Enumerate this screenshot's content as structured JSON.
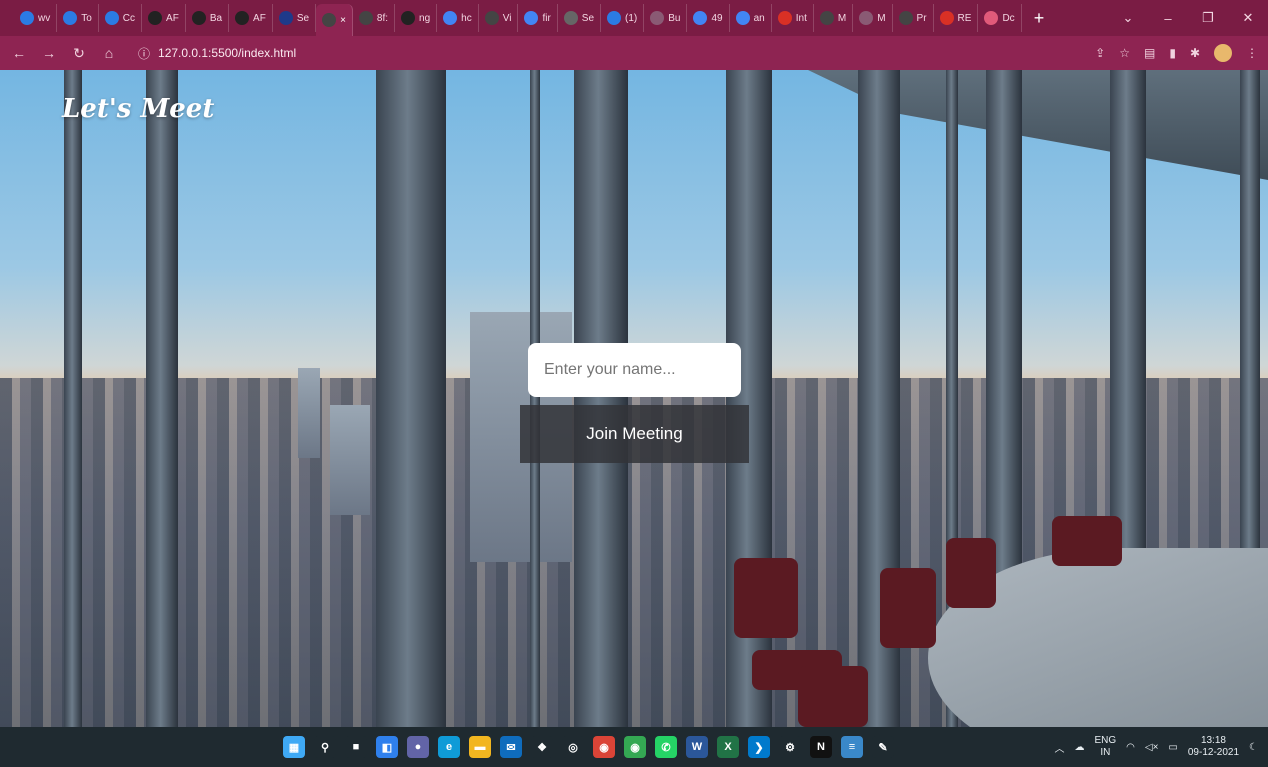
{
  "browser": {
    "tabs": [
      {
        "label": "wv",
        "icon": "site-icon",
        "color": "#2b7be4"
      },
      {
        "label": "To",
        "icon": "site-icon",
        "color": "#2b7be4"
      },
      {
        "label": "Cc",
        "icon": "site-icon",
        "color": "#2b7be4"
      },
      {
        "label": "AF",
        "icon": "github-icon",
        "color": "#222222"
      },
      {
        "label": "Ba",
        "icon": "github-icon",
        "color": "#222222"
      },
      {
        "label": "AF",
        "icon": "github-icon",
        "color": "#222222"
      },
      {
        "label": "Se",
        "icon": "n-icon",
        "color": "#1e3a8a"
      },
      {
        "label": "×",
        "icon": "globe-icon",
        "color": "#444444",
        "active": true
      },
      {
        "label": "8f:",
        "icon": "globe-icon",
        "color": "#444444"
      },
      {
        "label": "ng",
        "icon": "github-icon",
        "color": "#222222"
      },
      {
        "label": "hc",
        "icon": "google-icon",
        "color": "#4285f4"
      },
      {
        "label": "Vi",
        "icon": "globe-icon",
        "color": "#444444"
      },
      {
        "label": "fir",
        "icon": "google-icon",
        "color": "#4285f4"
      },
      {
        "label": "Se",
        "icon": "gear-icon",
        "color": "#666666"
      },
      {
        "label": "(1)",
        "icon": "site-icon",
        "color": "#2b7be4"
      },
      {
        "label": "Bu",
        "icon": "site-icon",
        "color": "#8a5a74"
      },
      {
        "label": "49",
        "icon": "google-icon",
        "color": "#4285f4"
      },
      {
        "label": "an",
        "icon": "google-icon",
        "color": "#4285f4"
      },
      {
        "label": "Int",
        "icon": "gmail-icon",
        "color": "#d93025"
      },
      {
        "label": "M",
        "icon": "globe-icon",
        "color": "#444444"
      },
      {
        "label": "M",
        "icon": "site-icon",
        "color": "#8a5a74"
      },
      {
        "label": "Pr",
        "icon": "globe-icon",
        "color": "#444444"
      },
      {
        "label": "RE",
        "icon": "gmail-icon",
        "color": "#d93025"
      },
      {
        "label": "Dc",
        "icon": "heart-icon",
        "color": "#e05a7a"
      }
    ],
    "new_tab": "+",
    "url": "127.0.0.1:5500/index.html"
  },
  "page": {
    "brand": "Let's Meet",
    "name_placeholder": "Enter your name...",
    "join_label": "Join Meeting"
  },
  "taskbar": {
    "apps": [
      {
        "name": "windows-start-icon",
        "color": "#3fa9f5",
        "glyph": "▦"
      },
      {
        "name": "search-icon",
        "color": "#1f2a30",
        "glyph": "⚲"
      },
      {
        "name": "task-view-icon",
        "color": "#1f2a30",
        "glyph": "■"
      },
      {
        "name": "widgets-icon",
        "color": "#2f80ed",
        "glyph": "◧"
      },
      {
        "name": "chat-icon",
        "color": "#6264a7",
        "glyph": "●"
      },
      {
        "name": "edge-icon",
        "color": "#0f9bd7",
        "glyph": "e"
      },
      {
        "name": "file-explorer-icon",
        "color": "#f2b620",
        "glyph": "▬"
      },
      {
        "name": "mail-icon",
        "color": "#0f6cbd",
        "glyph": "✉"
      },
      {
        "name": "dropbox-icon",
        "color": "#1f2a30",
        "glyph": "❖"
      },
      {
        "name": "github-desktop-icon",
        "color": "#1f2a30",
        "glyph": "◎"
      },
      {
        "name": "chrome-icon",
        "color": "#db4437",
        "glyph": "◉"
      },
      {
        "name": "chrome-alt-icon",
        "color": "#34a853",
        "glyph": "◉"
      },
      {
        "name": "whatsapp-icon",
        "color": "#25d366",
        "glyph": "✆"
      },
      {
        "name": "word-icon",
        "color": "#2b579a",
        "glyph": "W"
      },
      {
        "name": "excel-icon",
        "color": "#217346",
        "glyph": "X"
      },
      {
        "name": "vscode-icon",
        "color": "#007acc",
        "glyph": "❯"
      },
      {
        "name": "settings-icon",
        "color": "#1f2a30",
        "glyph": "⚙"
      },
      {
        "name": "netflix-icon",
        "color": "#111111",
        "glyph": "N"
      },
      {
        "name": "notepad-icon",
        "color": "#3a88c9",
        "glyph": "≡"
      },
      {
        "name": "paint-icon",
        "color": "#1f2a30",
        "glyph": "✎"
      }
    ],
    "lang_top": "ENG",
    "lang_bottom": "IN",
    "time": "13:18",
    "date": "09-12-2021"
  }
}
